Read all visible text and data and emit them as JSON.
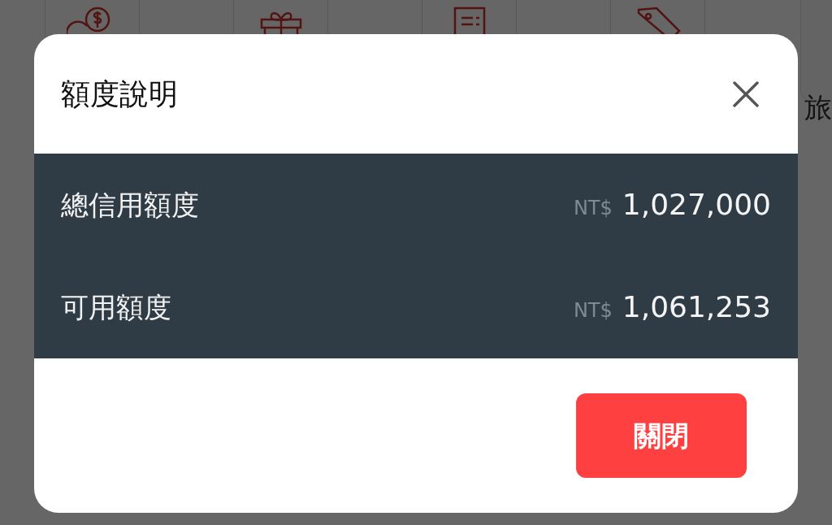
{
  "background": {
    "side_label": "旅"
  },
  "modal": {
    "title": "額度說明",
    "rows": [
      {
        "label": "總信用額度",
        "currency": "NT$",
        "amount": "1,027,000"
      },
      {
        "label": "可用額度",
        "currency": "NT$",
        "amount": "1,061,253"
      }
    ],
    "button": "關閉"
  }
}
